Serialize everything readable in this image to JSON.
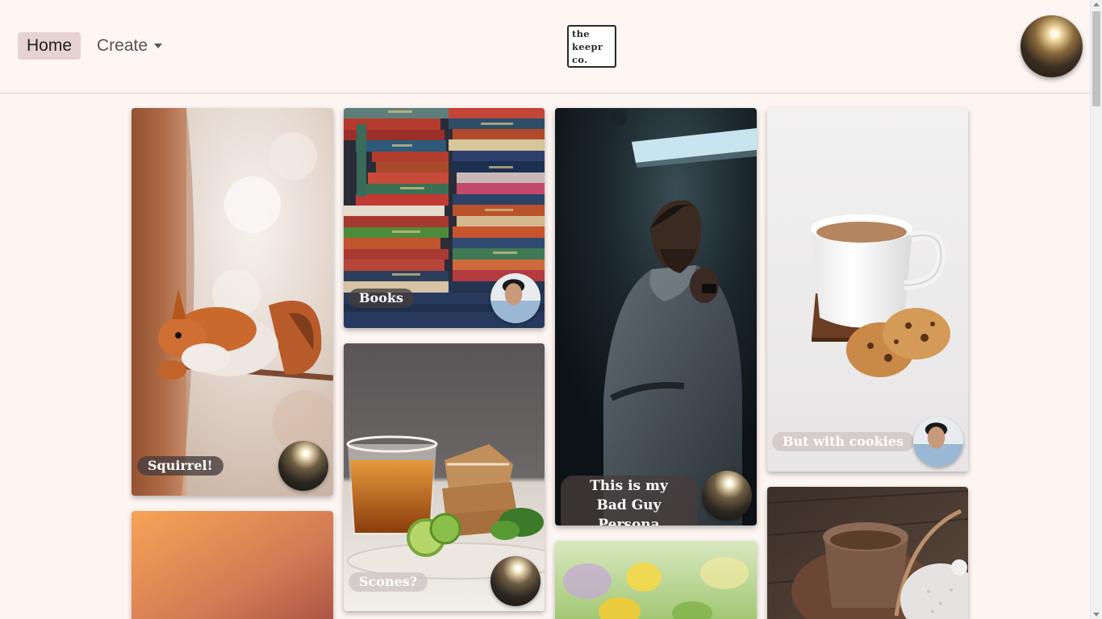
{
  "nav": {
    "home_label": "Home",
    "create_label": "Create",
    "logo_lines": [
      "the",
      "keepr",
      "co."
    ]
  },
  "cards": [
    {
      "title": "Squirrel!",
      "image": "squirrel-photo",
      "creator_avatar": "silhouette-avatar"
    },
    {
      "title": "Books",
      "image": "books-stack-photo",
      "creator_avatar": "man-portrait-avatar"
    },
    {
      "title": "Scones?",
      "image": "tea-scones-photo",
      "creator_avatar": "silhouette-avatar"
    },
    {
      "title": "This is my Bad Guy Persona",
      "image": "hooded-man-photo",
      "creator_avatar": "silhouette-avatar"
    },
    {
      "title": "But with cookies",
      "image": "tea-cookies-photo",
      "creator_avatar": "man-portrait-avatar"
    },
    {
      "title": "",
      "image": "orange-gradient-photo"
    },
    {
      "title": "",
      "image": "flower-meadow-photo"
    },
    {
      "title": "",
      "image": "tea-cup-teapot-photo"
    }
  ],
  "colors": {
    "background": "#fdf5f1",
    "home_pill": "#e6d3d1",
    "tag_dark": "#463c3c",
    "tag_light": "#d2c8ca"
  }
}
